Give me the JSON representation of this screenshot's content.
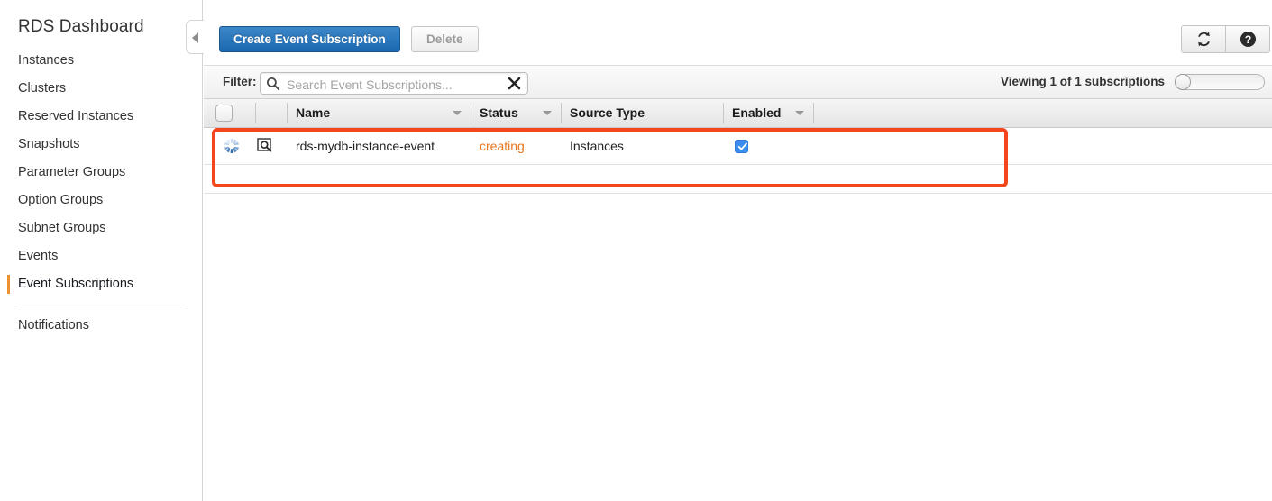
{
  "sidebar": {
    "title": "RDS Dashboard",
    "items": [
      {
        "label": "Instances",
        "active": false
      },
      {
        "label": "Clusters",
        "active": false
      },
      {
        "label": "Reserved Instances",
        "active": false
      },
      {
        "label": "Snapshots",
        "active": false
      },
      {
        "label": "Parameter Groups",
        "active": false
      },
      {
        "label": "Option Groups",
        "active": false
      },
      {
        "label": "Subnet Groups",
        "active": false
      },
      {
        "label": "Events",
        "active": false
      },
      {
        "label": "Event Subscriptions",
        "active": true
      },
      {
        "label": "Notifications",
        "active": false
      }
    ],
    "collapse_icon": "triangle-left-icon",
    "active_marker_color": "#ec912d"
  },
  "toolbar": {
    "create_label": "Create Event Subscription",
    "delete_label": "Delete",
    "refresh_icon": "refresh-icon",
    "help_icon": "help-icon",
    "primary_color": "#1c68b0"
  },
  "filter": {
    "label": "Filter:",
    "placeholder": "Search Event Subscriptions...",
    "value": "",
    "search_icon": "search-icon",
    "clear_icon": "close-icon",
    "viewing_text": "Viewing 1 of 1 subscriptions",
    "slider_value": 0
  },
  "table": {
    "columns": [
      {
        "label": "Name",
        "sortable": true
      },
      {
        "label": "Status",
        "sortable": true
      },
      {
        "label": "Source Type",
        "sortable": false
      },
      {
        "label": "Enabled",
        "sortable": true
      }
    ],
    "rows": [
      {
        "state_icon": "loading-spinner-icon",
        "detail_icon": "magnifier-box-icon",
        "name": "rds-mydb-instance-event",
        "status": "creating",
        "status_color": "#e8761e",
        "source_type": "Instances",
        "enabled": true
      }
    ]
  },
  "annotation": {
    "highlight_color": "#f4461e"
  }
}
